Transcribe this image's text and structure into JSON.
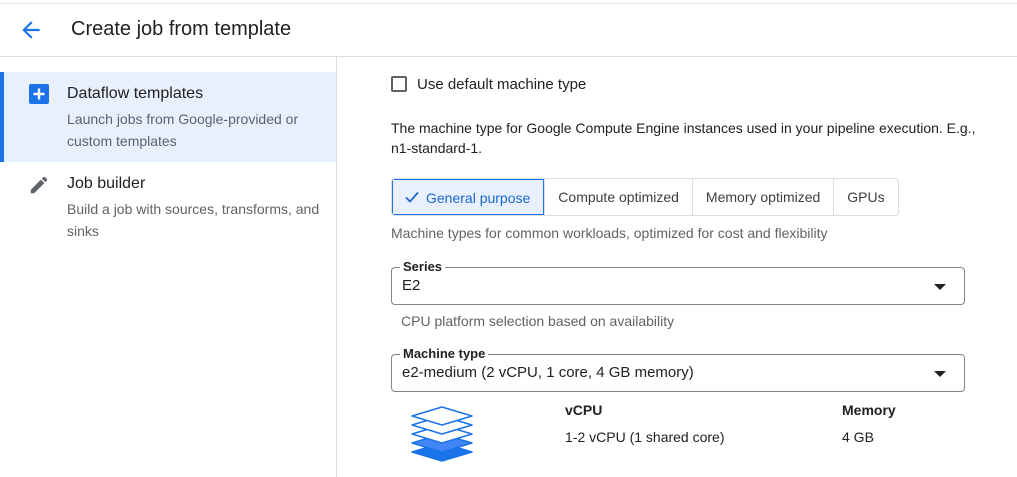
{
  "header": {
    "title": "Create job from template"
  },
  "sidebar": {
    "items": [
      {
        "title": "Dataflow templates",
        "subtitle": "Launch jobs from Google-provided or custom templates",
        "icon": "add-box-icon"
      },
      {
        "title": "Job builder",
        "subtitle": "Build a job with sources, transforms, and sinks",
        "icon": "pencil-icon"
      }
    ]
  },
  "main": {
    "default_machine": {
      "label": "Use default machine type",
      "checked": false
    },
    "description": "The machine type for Google Compute Engine instances used in your pipeline execution. E.g., n1-standard-1.",
    "tabs": [
      {
        "label": "General purpose",
        "selected": true
      },
      {
        "label": "Compute optimized",
        "selected": false
      },
      {
        "label": "Memory optimized",
        "selected": false
      },
      {
        "label": "GPUs",
        "selected": false
      }
    ],
    "tab_help": "Machine types for common workloads, optimized for cost and flexibility",
    "series": {
      "label": "Series",
      "value": "E2",
      "help": "CPU platform selection based on availability"
    },
    "machine_type": {
      "label": "Machine type",
      "value": "e2-medium (2 vCPU, 1 core, 4 GB memory)"
    },
    "specs": {
      "vcpu_label": "vCPU",
      "vcpu_value": "1-2 vCPU (1 shared core)",
      "memory_label": "Memory",
      "memory_value": "4 GB"
    }
  },
  "colors": {
    "accent": "#1a73e8",
    "active_bg": "#e8f0fe"
  }
}
